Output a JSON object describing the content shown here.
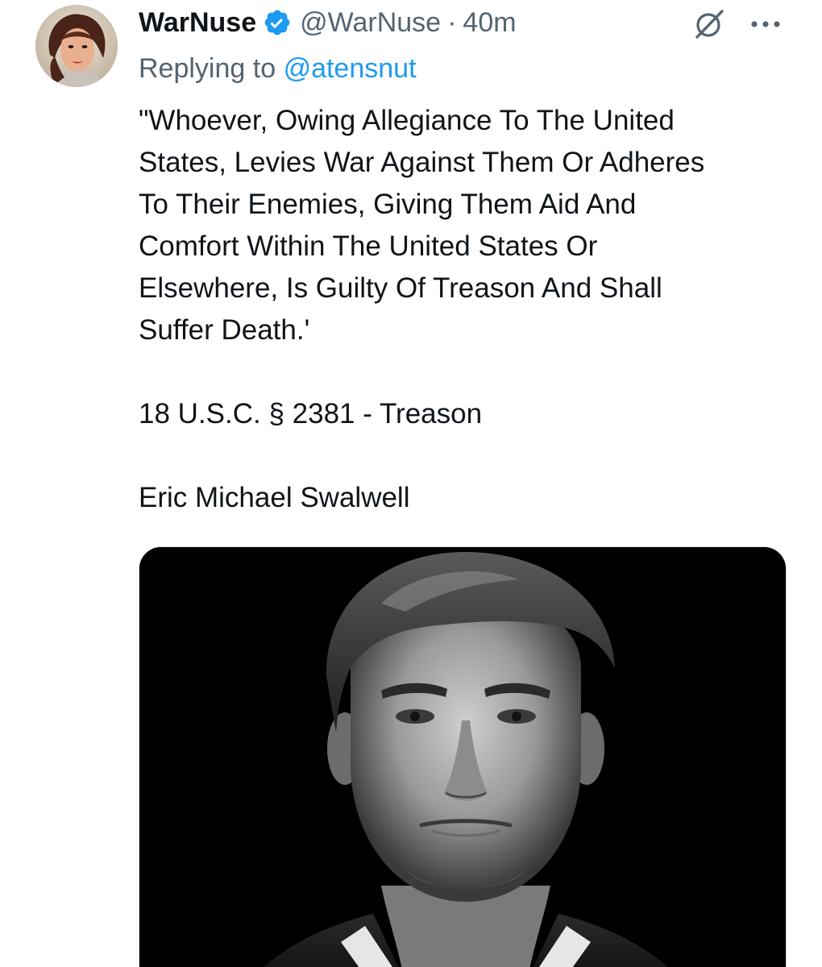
{
  "tweet": {
    "author": {
      "display_name": "WarNuse",
      "handle": "@WarNuse",
      "verified": true,
      "avatar_icon": "vintage-portrait-avatar"
    },
    "separator": "·",
    "timestamp": "40m",
    "replying_prefix": "Replying to",
    "replying_to": "@atensnut",
    "quote_lines": [
      "\"Whoever, Owing Allegiance To The United",
      "States, Levies War Against Them Or Adheres",
      "To Their Enemies, Giving Them Aid And",
      "Comfort Within The United States Or",
      "Elsewhere, Is Guilty Of Treason And Shall",
      "Suffer Death.'"
    ],
    "citation": "18 U.S.C. § 2381 - Treason",
    "name_line": "Eric Michael Swalwell",
    "media": {
      "kind": "black-and-white portrait photo"
    }
  },
  "icons": {
    "verified": "verified-badge-icon",
    "grok": "grok-icon",
    "more": "more-options-icon"
  },
  "colors": {
    "text": "#0f1419",
    "secondary": "#536471",
    "accent": "#1d9bf0"
  }
}
